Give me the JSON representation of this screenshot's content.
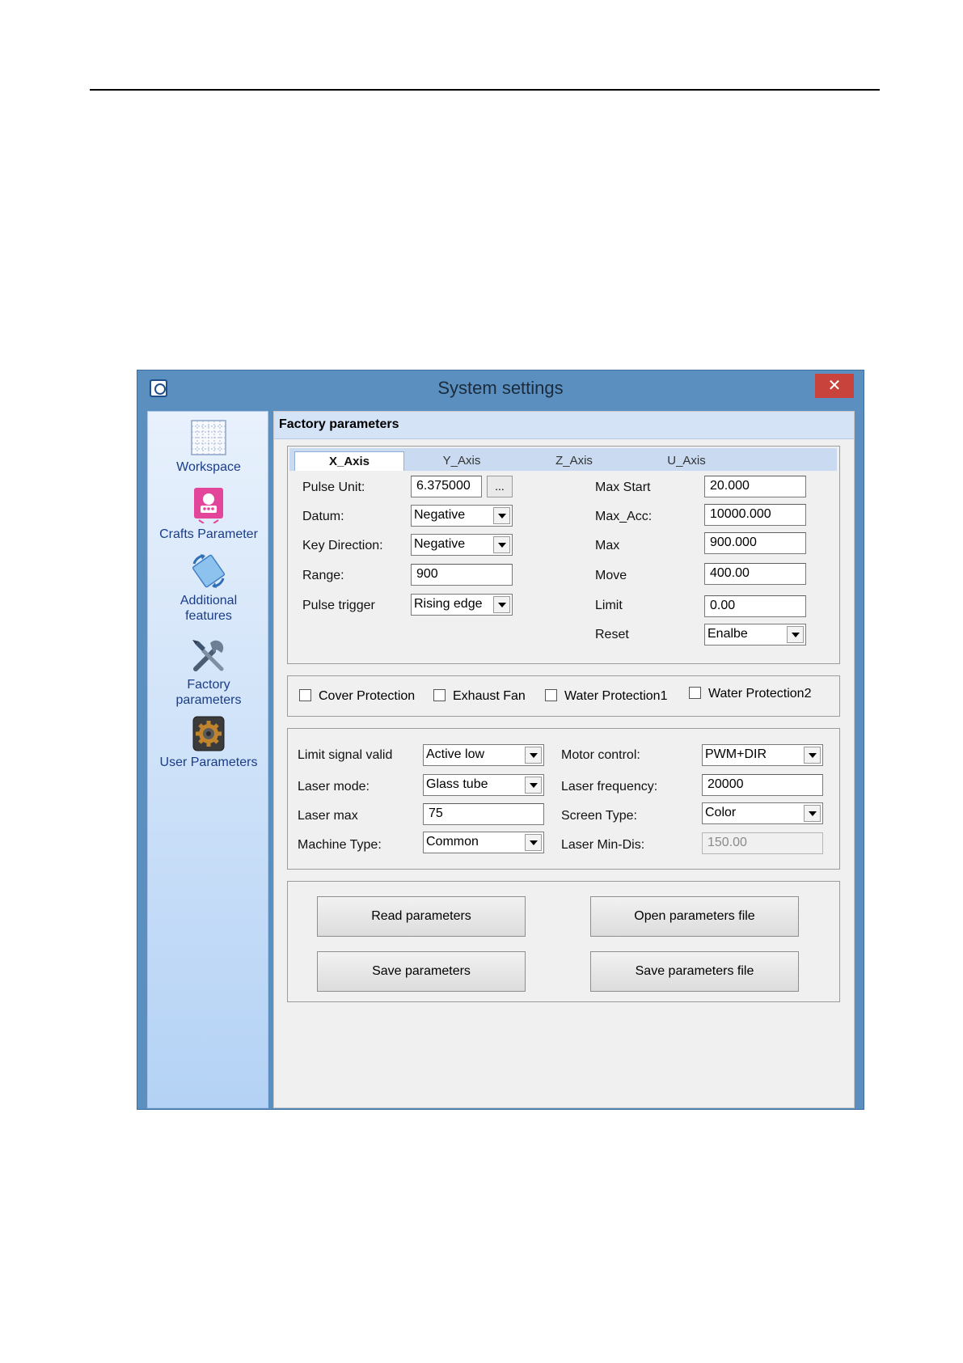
{
  "window": {
    "title": "System settings",
    "close_label": "✕"
  },
  "sidebar": {
    "items": [
      {
        "label": "Workspace",
        "icon": "grid-icon"
      },
      {
        "label": "Crafts Parameter",
        "icon": "robot-icon"
      },
      {
        "label_line1": "Additional",
        "label_line2": "features",
        "icon": "sync-icon"
      },
      {
        "label_line1": "Factory",
        "label_line2": "parameters",
        "icon": "tools-icon"
      },
      {
        "label": "User Parameters",
        "icon": "gear-icon"
      }
    ]
  },
  "header": {
    "title": "Factory parameters"
  },
  "axis_tabs": [
    "X_Axis",
    "Y_Axis",
    "Z_Axis",
    "U_Axis"
  ],
  "axis": {
    "pulse_unit_label": "Pulse Unit:",
    "pulse_unit_value": "6.375000",
    "browse_label": "...",
    "datum_label": "Datum:",
    "datum_value": "Negative",
    "key_direction_label": "Key Direction:",
    "key_direction_value": "Negative",
    "range_label": "Range:",
    "range_value": "900",
    "pulse_trigger_label": "Pulse trigger",
    "pulse_trigger_value": "Rising edge",
    "max_start_label": "Max Start",
    "max_start_value": "20.000",
    "max_acc_label": "Max_Acc:",
    "max_acc_value": "10000.000",
    "max_label": "Max",
    "max_value": "900.000",
    "move_label": "Move",
    "move_value": "400.00",
    "limit_label": "Limit",
    "limit_value": "0.00",
    "reset_label": "Reset",
    "reset_value": "Enalbe"
  },
  "protections": {
    "cover": "Cover Protection",
    "exhaust": "Exhaust Fan",
    "water1": "Water Protection1",
    "water2": "Water Protection2"
  },
  "machine": {
    "limit_signal_label": "Limit signal valid",
    "limit_signal_value": "Active low",
    "laser_mode_label": "Laser mode:",
    "laser_mode_value": "Glass tube",
    "laser_max_label": "Laser max",
    "laser_max_value": "75",
    "machine_type_label": "Machine Type:",
    "machine_type_value": "Common",
    "motor_control_label": "Motor control:",
    "motor_control_value": "PWM+DIR",
    "laser_freq_label": "Laser frequency:",
    "laser_freq_value": "20000",
    "screen_type_label": "Screen Type:",
    "screen_type_value": "Color",
    "laser_min_dis_label": "Laser Min-Dis:",
    "laser_min_dis_value": "150.00"
  },
  "actions": {
    "read": "Read parameters",
    "open_file": "Open parameters file",
    "save": "Save parameters",
    "save_file": "Save parameters file"
  },
  "colors": {
    "titlebar": "#5b8fbf",
    "close": "#c8433b",
    "sidebar_text": "#1a3d8a",
    "header": "#d5e3f6"
  }
}
